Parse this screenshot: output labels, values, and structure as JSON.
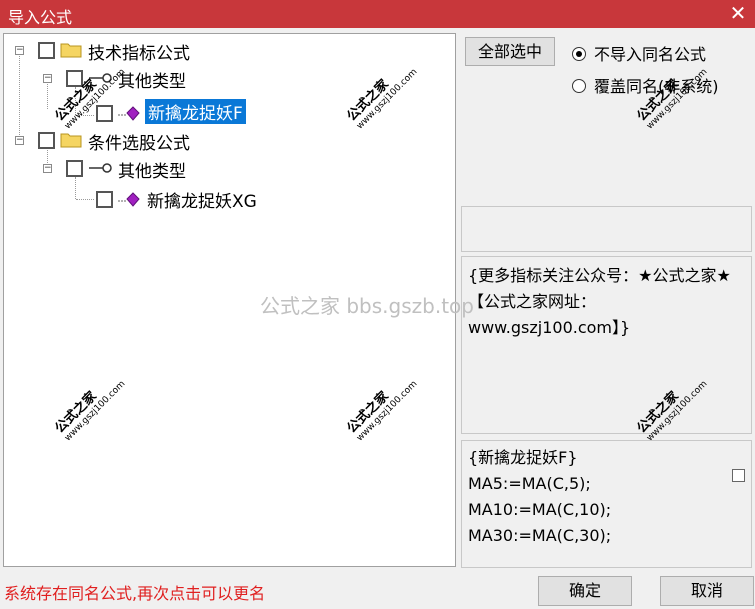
{
  "window": {
    "title": "导入公式",
    "close_glyph": "✕"
  },
  "tree": {
    "nodes": [
      {
        "label": "技术指标公式",
        "icon": "folder-icon"
      },
      {
        "label": "其他类型",
        "icon": "key-icon"
      },
      {
        "label": "新擒龙捉妖F",
        "icon": "formula-gem-icon",
        "selected": true
      },
      {
        "label": "条件选股公式",
        "icon": "folder-icon"
      },
      {
        "label": "其他类型",
        "icon": "key-icon"
      },
      {
        "label": "新擒龙捉妖XG",
        "icon": "formula-gem-icon"
      }
    ]
  },
  "options": {
    "select_all_label": "全部选中",
    "radio_no_import": "不导入同名公式",
    "radio_overwrite": "覆盖同名(非系统)",
    "selected": "no_import"
  },
  "description": "{更多指标关注公众号：★公式之家★ 【公式之家网址：www.gszj100.com】}",
  "code": {
    "lines": [
      "{新擒龙捉妖F}",
      "MA5:=MA(C,5);",
      "MA10:=MA(C,10);",
      "MA30:=MA(C,30);"
    ]
  },
  "status_message": "系统存在同名公式,再次点击可以更名",
  "buttons": {
    "ok": "确定",
    "cancel": "取消"
  },
  "watermarks": {
    "stamp_text": "公式之家",
    "stamp_url": "www.gszj100.com",
    "center_text": "公式之家 bbs.gszb.top"
  },
  "colors": {
    "title_bar": "#c8373b",
    "selection": "#0a78d7",
    "status_text": "#e02020"
  }
}
